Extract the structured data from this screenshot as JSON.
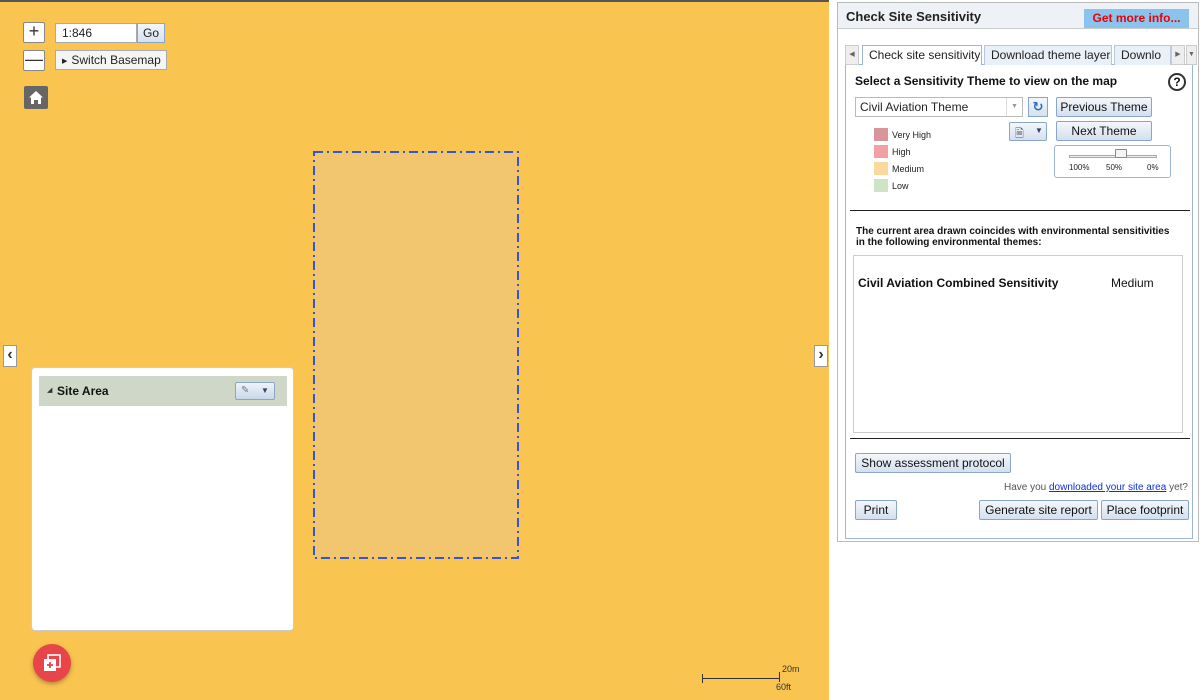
{
  "map": {
    "scale_value": "1:846",
    "go_label": "Go",
    "switch_basemap_label": "Switch Basemap",
    "zoom_in_label": "+",
    "zoom_out_label": "—",
    "background_color": "#f9c450",
    "scalebar": {
      "top_label": "20m",
      "bottom_label": "60ft"
    }
  },
  "site_panel": {
    "title": "Site Area"
  },
  "panel": {
    "title": "Check Site Sensitivity",
    "more_info_label": "Get more info...",
    "tabs": [
      {
        "label": "Check site sensitivity",
        "active": true
      },
      {
        "label": "Download theme layers",
        "active": false
      },
      {
        "label": "Downlo",
        "active": false
      }
    ],
    "theme_heading": "Select a Sensitivity Theme to view on the map",
    "help_label": "?",
    "theme_select_value": "Civil Aviation Theme",
    "previous_theme_label": "Previous Theme",
    "next_theme_label": "Next Theme",
    "legend": [
      {
        "label": "Very High",
        "color": "#d9969a"
      },
      {
        "label": "High",
        "color": "#f3a0a4"
      },
      {
        "label": "Medium",
        "color": "#fbd89c"
      },
      {
        "label": "Low",
        "color": "#cfe3c7"
      }
    ],
    "opacity_labels": [
      "100%",
      "50%",
      "0%"
    ],
    "opacity_value_percent": 50,
    "coincide_text": "The current area drawn coincides with environmental sensitivities in the following environmental themes:",
    "results": [
      {
        "name": "Civil Aviation Combined Sensitivity",
        "value": "Medium"
      }
    ],
    "assessment_label": "Show assessment protocol",
    "download_note_prefix": "Have you ",
    "download_note_link": "downloaded your site area",
    "download_note_suffix": " yet?",
    "print_label": "Print",
    "report_label": "Generate site report",
    "footprint_label": "Place footprint"
  },
  "colors": {
    "accent_button_bg": "#8bc3ef",
    "more_info_text": "#ee0000",
    "fab": "#e8454a",
    "footprint_outline": "#3355d8"
  }
}
